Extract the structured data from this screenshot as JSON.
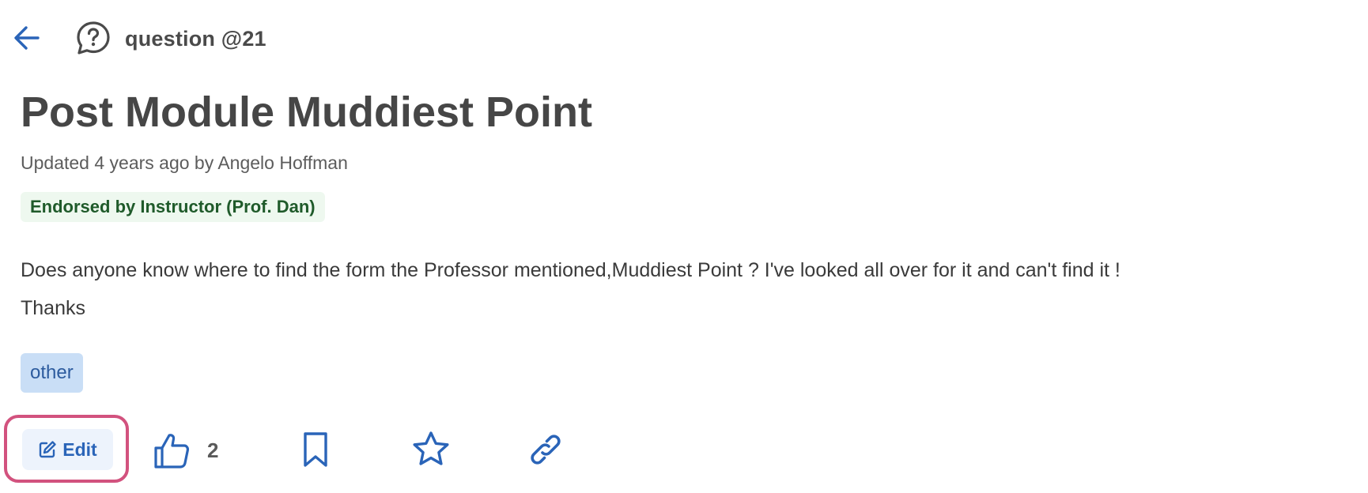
{
  "header": {
    "post_type": "question @21"
  },
  "post": {
    "title": "Post Module Muddiest Point",
    "meta": "Updated 4 years ago by Angelo Hoffman",
    "endorsement": "Endorsed by Instructor (Prof. Dan)",
    "body_line_1": "Does anyone know where to find the form the Professor mentioned,Muddiest Point ? I've looked all over for it and can't find it !",
    "body_line_2": "Thanks",
    "tag": "other"
  },
  "actions": {
    "edit_label": "Edit",
    "like_count": "2"
  },
  "colors": {
    "accent_blue": "#2a64b8",
    "focus_outline": "#d2527e",
    "endorse_bg": "#eef8ef",
    "endorse_text": "#1f5a2a",
    "tag_bg": "#c9def6"
  },
  "icons": {
    "back": "arrow-left-icon",
    "post_type": "question-bubble-icon",
    "edit": "pencil-square-icon",
    "like": "thumbs-up-icon",
    "bookmark": "bookmark-icon",
    "star": "star-icon",
    "link": "link-icon"
  }
}
